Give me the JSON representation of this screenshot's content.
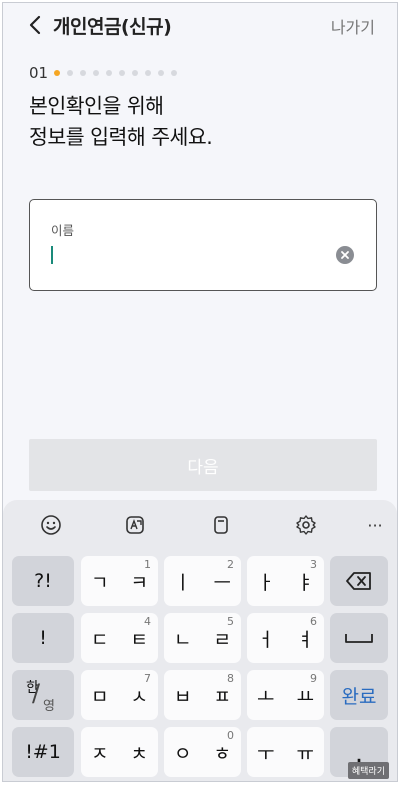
{
  "header": {
    "title": "개인연금(신규)",
    "exit_label": "나가기"
  },
  "step": {
    "current": "01",
    "total_dots": 10,
    "active_index": 0
  },
  "heading": {
    "line1": "본인확인을 위해",
    "line2": "정보를 입력해 주세요."
  },
  "name_field": {
    "label": "이름",
    "value": ""
  },
  "next_button": {
    "label": "다음"
  },
  "keyboard": {
    "toolbar": [
      "emoji-icon",
      "text-recognition-icon",
      "clipboard-icon",
      "settings-icon",
      "more-icon"
    ],
    "more_label": "···",
    "rows": [
      {
        "left": "?!",
        "keys": [
          {
            "label": "ㄱ ㅋ",
            "num": "1"
          },
          {
            "label": "ㅣ ㅡ",
            "num": "2"
          },
          {
            "label": "ㅏ ㅑ",
            "num": "3"
          }
        ],
        "right_icon": "backspace-icon"
      },
      {
        "left": "!",
        "keys": [
          {
            "label": "ㄷ ㅌ",
            "num": "4"
          },
          {
            "label": "ㄴ ㄹ",
            "num": "5"
          },
          {
            "label": "ㅓ ㅕ",
            "num": "6"
          }
        ],
        "right_icon": "space-icon"
      },
      {
        "left_han": "한",
        "left_eng": "영",
        "keys": [
          {
            "label": "ㅁ ㅅ",
            "num": "7"
          },
          {
            "label": "ㅂ ㅍ",
            "num": "8"
          },
          {
            "label": "ㅗ ㅛ",
            "num": "9"
          }
        ],
        "right": "완료"
      },
      {
        "left": "!#1",
        "keys": [
          {
            "label": "ㅈ ㅊ",
            "num": ""
          },
          {
            "label": "ㅇ ㅎ",
            "num": "0"
          },
          {
            "label": "ㅜ ㅠ",
            "num": ""
          }
        ],
        "right": "."
      }
    ]
  },
  "watermark": "혜택라기"
}
